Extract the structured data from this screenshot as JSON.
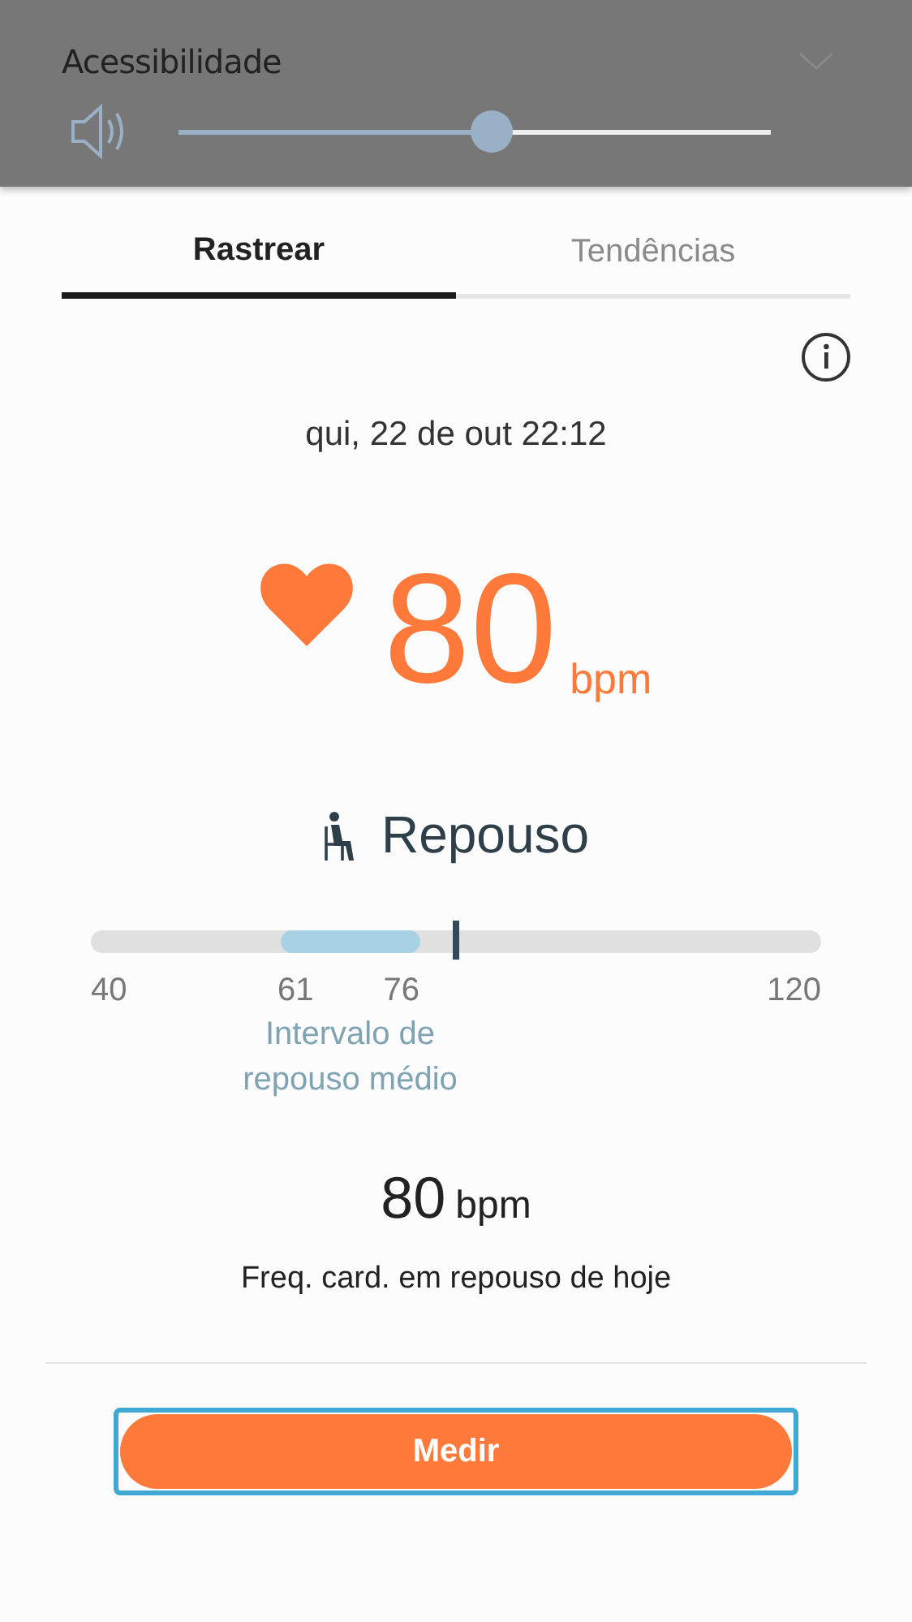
{
  "panel": {
    "title": "Acessibilidade",
    "volume": {
      "level": 0.53
    }
  },
  "tabs": [
    {
      "label": "Rastrear",
      "selected": true
    },
    {
      "label": "Tendências",
      "selected": false
    }
  ],
  "timestamp": "qui, 22 de out 22:12",
  "reading": {
    "value": "80",
    "unit": "bpm"
  },
  "state": {
    "label": "Repouso"
  },
  "scale": {
    "min": "40",
    "max": "120",
    "band_start": {
      "label": "61"
    },
    "band_end": {
      "label": "76"
    },
    "marker": {
      "level": 0.5
    },
    "band_caption": "Intervalo de repouso médio"
  },
  "resting": {
    "value": "80",
    "unit": "bpm",
    "caption": "Freq. card. em repouso de hoje"
  },
  "buttons": [
    {
      "label": "Medir",
      "focused": true
    }
  ]
}
